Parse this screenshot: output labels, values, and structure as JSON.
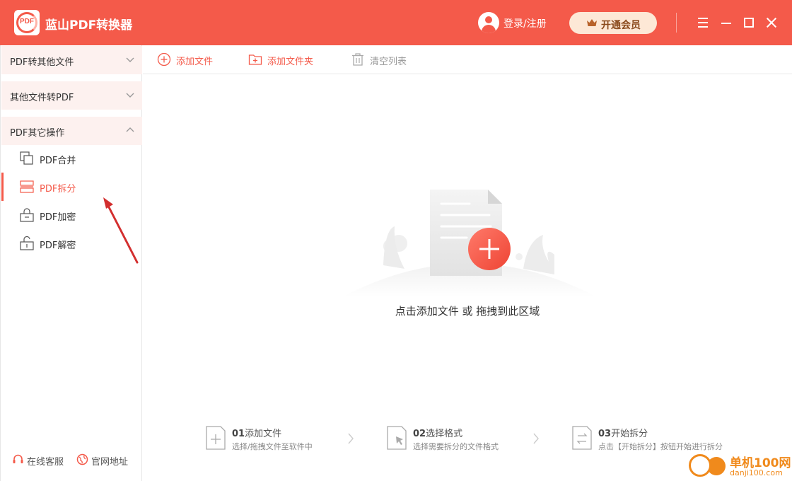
{
  "app": {
    "title": "蓝山PDF转换器",
    "logo_text": "PDF"
  },
  "header": {
    "login_label": "登录/注册",
    "vip_label": "开通会员",
    "brand_color": "#f45a4a",
    "vip_bg": "#fde8d6"
  },
  "sidebar": {
    "categories": [
      {
        "label": "PDF转其他文件",
        "expanded": false
      },
      {
        "label": "其他文件转PDF",
        "expanded": false
      },
      {
        "label": "PDF其它操作",
        "expanded": true
      }
    ],
    "items": [
      {
        "label": "PDF合并",
        "icon": "merge-icon",
        "active": false
      },
      {
        "label": "PDF拆分",
        "icon": "split-icon",
        "active": true
      },
      {
        "label": "PDF加密",
        "icon": "lock-icon",
        "active": false
      },
      {
        "label": "PDF解密",
        "icon": "unlock-icon",
        "active": false
      }
    ],
    "footer": {
      "support_label": "在线客服",
      "website_label": "官网地址"
    }
  },
  "toolbar": {
    "add_file_label": "添加文件",
    "add_folder_label": "添加文件夹",
    "clear_list_label": "清空列表"
  },
  "dropzone": {
    "prompt": "点击添加文件 或 拖拽到此区域"
  },
  "steps": [
    {
      "num": "01",
      "title": "添加文件",
      "desc": "选择/拖拽文件至软件中"
    },
    {
      "num": "02",
      "title": "选择格式",
      "desc": "选择需要拆分的文件格式"
    },
    {
      "num": "03",
      "title": "开始拆分",
      "desc": "点击【开始拆分】按钮开始进行拆分"
    }
  ],
  "watermark": {
    "name": "单机100网",
    "url": "danji100.com"
  }
}
